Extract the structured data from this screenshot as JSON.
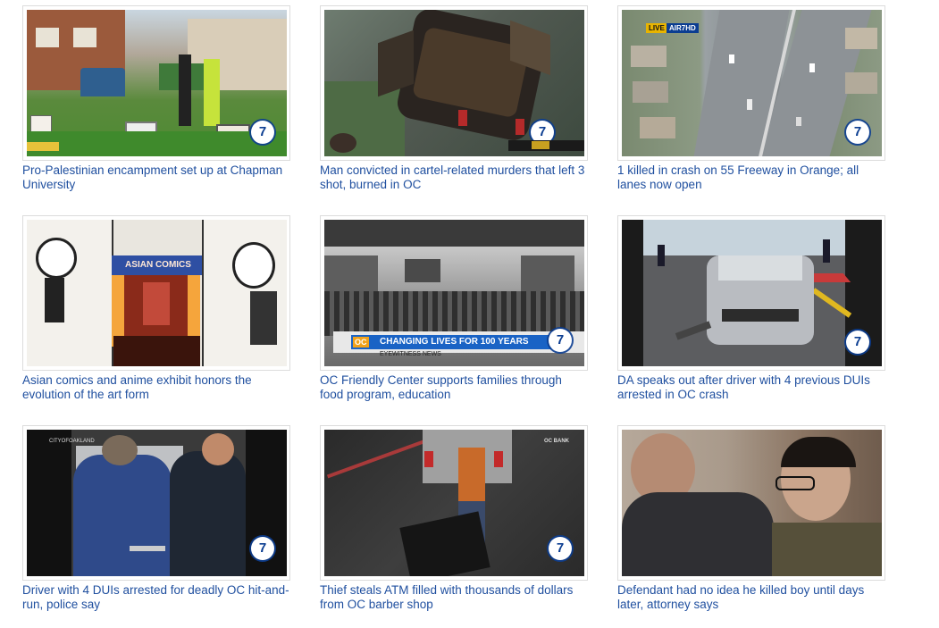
{
  "grid": {
    "cards": [
      {
        "caption": "Pro-Palestinian encampment set up at Chapman University",
        "logo": "abc7"
      },
      {
        "caption": "Man convicted in cartel-related murders that left 3 shot, burned in OC",
        "logo": "abc7"
      },
      {
        "caption": "1 killed in crash on 55 Freeway in Orange; all lanes now open",
        "logo": "abc7",
        "badge": "LIVE",
        "badge_sub": "AIR7HD"
      },
      {
        "caption": "Asian comics and anime exhibit honors the evolution of the art form",
        "sign": "ASIAN COMICS"
      },
      {
        "caption": "OC Friendly Center supports families through food program, education",
        "logo": "abc7",
        "banner": "CHANGING LIVES FOR 100 YEARS",
        "banner_sub": "EYEWITNESS NEWS",
        "banner_tag": "OC"
      },
      {
        "caption": "DA speaks out after driver with 4 previous DUIs arrested in OC crash",
        "logo": "abc7"
      },
      {
        "caption": "Driver with 4 DUIs arrested for deadly OC hit-and-run, police say",
        "logo": "abc7",
        "watermark": "CITYOFOAKLAND"
      },
      {
        "caption": "Thief steals ATM filled with thousands of dollars from OC barber shop",
        "logo": "abc7",
        "sign": "OC BANK"
      },
      {
        "caption": "Defendant had no idea he killed boy until days later, attorney says"
      }
    ]
  },
  "colors": {
    "link": "#1f4f9f",
    "border": "#dcdcdc",
    "abc_blue": "#0b3d91"
  },
  "icons": {
    "logo": "abc7-logo"
  }
}
